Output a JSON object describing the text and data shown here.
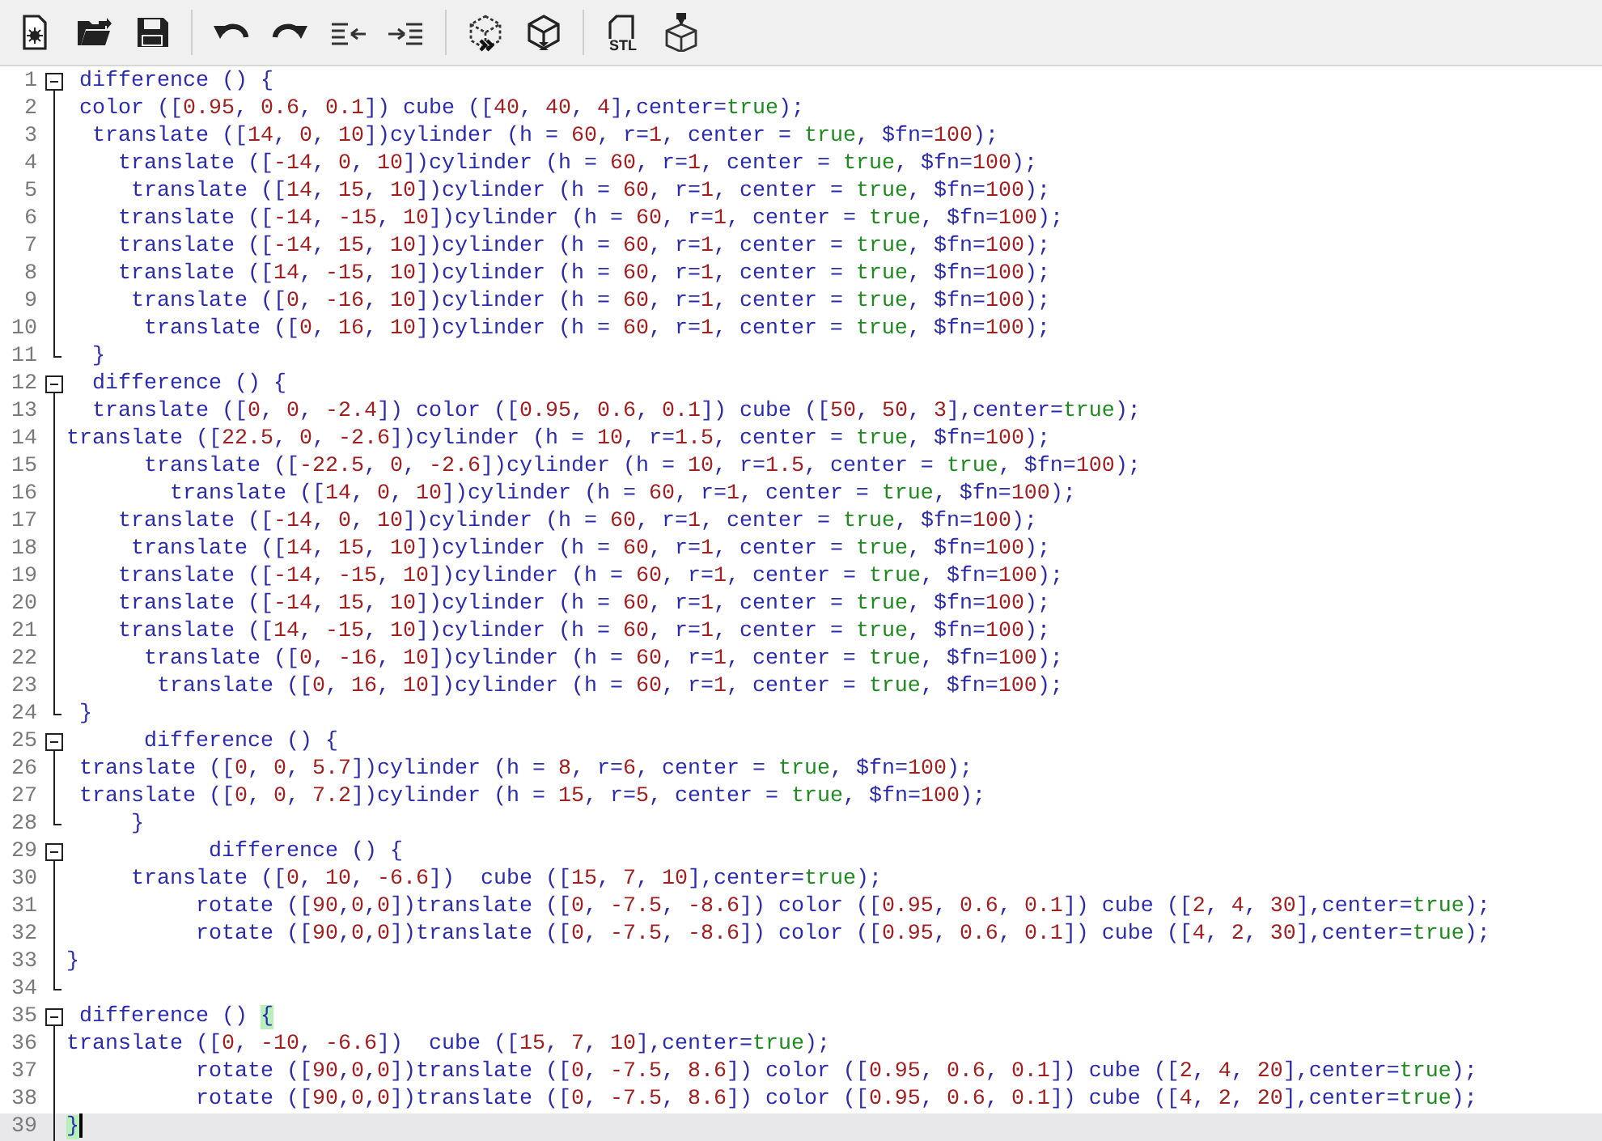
{
  "toolbar": {
    "groups": [
      {
        "buttons": [
          {
            "kind": "new"
          },
          {
            "kind": "open"
          },
          {
            "kind": "save"
          }
        ]
      },
      {
        "buttons": [
          {
            "kind": "undo"
          },
          {
            "kind": "redo"
          },
          {
            "kind": "unindent"
          },
          {
            "kind": "indent"
          }
        ]
      },
      {
        "buttons": [
          {
            "kind": "preview"
          },
          {
            "kind": "render"
          }
        ]
      },
      {
        "buttons": [
          {
            "kind": "stl",
            "label": "STL"
          },
          {
            "kind": "print"
          }
        ]
      }
    ]
  },
  "editor": {
    "lines": [
      {
        "number": "1",
        "kind": "start",
        "current": false,
        "code": [
          " difference () {"
        ]
      },
      {
        "number": "2",
        "kind": "body",
        "current": false,
        "code": [
          " color ([0.95, 0.6, 0.1]) cube ([40, 40, 4],center=",
          {
            "text": "true",
            "kind": "literal"
          },
          ");"
        ]
      },
      {
        "number": "3",
        "kind": "body",
        "current": false,
        "code": [
          "  translate ([14, 0, 10])cylinder (h = 60, r=1, center = ",
          {
            "text": "true",
            "kind": "literal"
          },
          ", $fn=100);"
        ]
      },
      {
        "number": "4",
        "kind": "body",
        "current": false,
        "code": [
          "    translate ([-14, 0, 10])cylinder (h = 60, r=1, center = ",
          {
            "text": "true",
            "kind": "literal"
          },
          ", $fn=100);"
        ]
      },
      {
        "number": "5",
        "kind": "body",
        "current": false,
        "code": [
          "     translate ([14, 15, 10])cylinder (h = 60, r=1, center = ",
          {
            "text": "true",
            "kind": "literal"
          },
          ", $fn=100);"
        ]
      },
      {
        "number": "6",
        "kind": "body",
        "current": false,
        "code": [
          "    translate ([-14, -15, 10])cylinder (h = 60, r=1, center = ",
          {
            "text": "true",
            "kind": "literal"
          },
          ", $fn=100);"
        ]
      },
      {
        "number": "7",
        "kind": "body",
        "current": false,
        "code": [
          "    translate ([-14, 15, 10])cylinder (h = 60, r=1, center = ",
          {
            "text": "true",
            "kind": "literal"
          },
          ", $fn=100);"
        ]
      },
      {
        "number": "8",
        "kind": "body",
        "current": false,
        "code": [
          "    translate ([14, -15, 10])cylinder (h = 60, r=1, center = ",
          {
            "text": "true",
            "kind": "literal"
          },
          ", $fn=100);"
        ]
      },
      {
        "number": "9",
        "kind": "body",
        "current": false,
        "code": [
          "     translate ([0, -16, 10])cylinder (h = 60, r=1, center = ",
          {
            "text": "true",
            "kind": "literal"
          },
          ", $fn=100);"
        ]
      },
      {
        "number": "10",
        "kind": "body",
        "current": false,
        "code": [
          "      translate ([0, 16, 10])cylinder (h = 60, r=1, center = ",
          {
            "text": "true",
            "kind": "literal"
          },
          ", $fn=100);"
        ]
      },
      {
        "number": "11",
        "kind": "end",
        "current": false,
        "code": [
          "  }"
        ]
      },
      {
        "number": "12",
        "kind": "start",
        "current": false,
        "code": [
          "  difference () {"
        ]
      },
      {
        "number": "13",
        "kind": "body",
        "current": false,
        "code": [
          "  translate ([0, 0, -2.4]) color ([0.95, 0.6, 0.1]) cube ([50, 50, 3],center=",
          {
            "text": "true",
            "kind": "literal"
          },
          ");"
        ]
      },
      {
        "number": "14",
        "kind": "body",
        "current": false,
        "code": [
          "translate ([22.5, 0, -2.6])cylinder (h = 10, r=1.5, center = ",
          {
            "text": "true",
            "kind": "literal"
          },
          ", $fn=100);"
        ]
      },
      {
        "number": "15",
        "kind": "body",
        "current": false,
        "code": [
          "      translate ([-22.5, 0, -2.6])cylinder (h = 10, r=1.5, center = ",
          {
            "text": "true",
            "kind": "literal"
          },
          ", $fn=100);"
        ]
      },
      {
        "number": "16",
        "kind": "body",
        "current": false,
        "code": [
          "        translate ([14, 0, 10])cylinder (h = 60, r=1, center = ",
          {
            "text": "true",
            "kind": "literal"
          },
          ", $fn=100);"
        ]
      },
      {
        "number": "17",
        "kind": "body",
        "current": false,
        "code": [
          "    translate ([-14, 0, 10])cylinder (h = 60, r=1, center = ",
          {
            "text": "true",
            "kind": "literal"
          },
          ", $fn=100);"
        ]
      },
      {
        "number": "18",
        "kind": "body",
        "current": false,
        "code": [
          "     translate ([14, 15, 10])cylinder (h = 60, r=1, center = ",
          {
            "text": "true",
            "kind": "literal"
          },
          ", $fn=100);"
        ]
      },
      {
        "number": "19",
        "kind": "body",
        "current": false,
        "code": [
          "    translate ([-14, -15, 10])cylinder (h = 60, r=1, center = ",
          {
            "text": "true",
            "kind": "literal"
          },
          ", $fn=100);"
        ]
      },
      {
        "number": "20",
        "kind": "body",
        "current": false,
        "code": [
          "    translate ([-14, 15, 10])cylinder (h = 60, r=1, center = ",
          {
            "text": "true",
            "kind": "literal"
          },
          ", $fn=100);"
        ]
      },
      {
        "number": "21",
        "kind": "body",
        "current": false,
        "code": [
          "    translate ([14, -15, 10])cylinder (h = 60, r=1, center = ",
          {
            "text": "true",
            "kind": "literal"
          },
          ", $fn=100);"
        ]
      },
      {
        "number": "22",
        "kind": "body",
        "current": false,
        "code": [
          "      translate ([0, -16, 10])cylinder (h = 60, r=1, center = ",
          {
            "text": "true",
            "kind": "literal"
          },
          ", $fn=100);"
        ]
      },
      {
        "number": "23",
        "kind": "body",
        "current": false,
        "code": [
          "       translate ([0, 16, 10])cylinder (h = 60, r=1, center = ",
          {
            "text": "true",
            "kind": "literal"
          },
          ", $fn=100);"
        ]
      },
      {
        "number": "24",
        "kind": "end",
        "current": false,
        "code": [
          " }"
        ]
      },
      {
        "number": "25",
        "kind": "start",
        "current": false,
        "code": [
          "      difference () {"
        ]
      },
      {
        "number": "26",
        "kind": "body",
        "current": false,
        "code": [
          " translate ([0, 0, 5.7])cylinder (h = 8, r=6, center = ",
          {
            "text": "true",
            "kind": "literal"
          },
          ", $fn=100);"
        ]
      },
      {
        "number": "27",
        "kind": "body",
        "current": false,
        "code": [
          " translate ([0, 0, 7.2])cylinder (h = 15, r=5, center = ",
          {
            "text": "true",
            "kind": "literal"
          },
          ", $fn=100);"
        ]
      },
      {
        "number": "28",
        "kind": "end",
        "current": false,
        "code": [
          "     }"
        ]
      },
      {
        "number": "29",
        "kind": "start",
        "current": false,
        "code": [
          "           difference () {"
        ]
      },
      {
        "number": "30",
        "kind": "body",
        "current": false,
        "code": [
          "     translate ([0, 10, -6.6])  cube ([15, 7, 10],center=",
          {
            "text": "true",
            "kind": "literal"
          },
          ");"
        ]
      },
      {
        "number": "31",
        "kind": "body",
        "current": false,
        "code": [
          "          rotate ([90,0,0])translate ([0, -7.5, -8.6]) color ([0.95, 0.6, 0.1]) cube ([2, 4, 30],center=",
          {
            "text": "true",
            "kind": "literal"
          },
          ");"
        ]
      },
      {
        "number": "32",
        "kind": "body",
        "current": false,
        "code": [
          "          rotate ([90,0,0])translate ([0, -7.5, -8.6]) color ([0.95, 0.6, 0.1]) cube ([4, 2, 30],center=",
          {
            "text": "true",
            "kind": "literal"
          },
          ");"
        ]
      },
      {
        "number": "33",
        "kind": "body",
        "current": false,
        "code": [
          "}"
        ]
      },
      {
        "number": "34",
        "kind": "end",
        "current": false
      },
      {
        "number": "35",
        "kind": "start",
        "current": false,
        "code": [
          " difference () ",
          {
            "text": "{",
            "kind": "match"
          }
        ]
      },
      {
        "number": "36",
        "kind": "body",
        "current": false,
        "code": [
          "translate ([0, -10, -6.6])  cube ([15, 7, 10],center=",
          {
            "text": "true",
            "kind": "literal"
          },
          ");"
        ]
      },
      {
        "number": "37",
        "kind": "body",
        "current": false,
        "code": [
          "          rotate ([90,0,0])translate ([0, -7.5, 8.6]) color ([0.95, 0.6, 0.1]) cube ([2, 4, 20],center=",
          {
            "text": "true",
            "kind": "literal"
          },
          ");"
        ]
      },
      {
        "number": "38",
        "kind": "body",
        "current": false,
        "code": [
          "          rotate ([90,0,0])translate ([0, -7.5, 8.6]) color ([0.95, 0.6, 0.1]) cube ([4, 2, 20],center=",
          {
            "text": "true",
            "kind": "literal"
          },
          ");"
        ]
      },
      {
        "number": "39",
        "kind": "body",
        "current": true,
        "code": [
          {
            "text": "}",
            "kind": "match"
          }
        ]
      }
    ]
  }
}
